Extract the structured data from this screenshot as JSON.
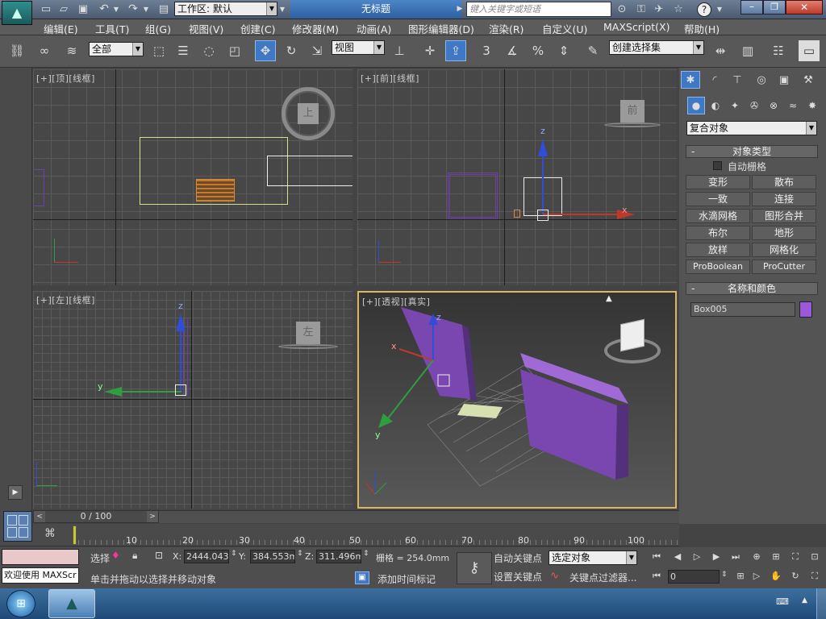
{
  "titlebar": {
    "workspace_label": "工作区: 默认",
    "doc_title": "无标题",
    "search_placeholder": "键入关键字或短语"
  },
  "menu": [
    "编辑(E)",
    "工具(T)",
    "组(G)",
    "视图(V)",
    "创建(C)",
    "修改器(M)",
    "动画(A)",
    "图形编辑器(D)",
    "渲染(R)",
    "自定义(U)",
    "MAXScript(X)",
    "帮助(H)"
  ],
  "toolbar": {
    "filter_value": "全部",
    "ref_coord_value": "视图",
    "snap_number": "3",
    "selection_set_value": "创建选择集"
  },
  "viewports": {
    "top": {
      "label": "[+][顶][线框]",
      "cube_label": "上"
    },
    "front": {
      "label": "[+][前][线框]",
      "cube_label": "前",
      "axis_x": "x",
      "axis_z": "z"
    },
    "left": {
      "label": "[+][左][线框]",
      "cube_label": "左",
      "axis_y": "y",
      "axis_z": "z"
    },
    "perspective": {
      "label": "[+][透视][真实]",
      "axis_x": "x",
      "axis_y": "y",
      "axis_z": "z"
    }
  },
  "command_panel": {
    "category_value": "复合对象",
    "object_type_header": "对象类型",
    "autogrid_label": "自动栅格",
    "buttons": [
      "变形",
      "散布",
      "一致",
      "连接",
      "水滴网格",
      "图形合并",
      "布尔",
      "地形",
      "放样",
      "网格化",
      "ProBoolean",
      "ProCutter"
    ],
    "name_color_header": "名称和颜色",
    "object_name": "Box005",
    "object_color": "#9b59d9"
  },
  "timeline": {
    "frame_display": "0 / 100",
    "ticks": [
      "10",
      "20",
      "30",
      "40",
      "50",
      "60",
      "70",
      "80",
      "90",
      "100"
    ]
  },
  "status": {
    "maxscript_label": "欢迎使用 MAXScr",
    "selection_label": "选择",
    "x_label": "X:",
    "x_value": "2444.043m",
    "y_label": "Y:",
    "y_value": "384.553mr",
    "z_label": "Z:",
    "z_value": "311.496mr",
    "grid_label": "栅格 = 254.0mm",
    "prompt": "单击并拖动以选择并移动对象",
    "add_time_tag": "添加时间标记",
    "auto_key": "自动关键点",
    "set_key": "设置关键点",
    "key_mode_value": "选定对象",
    "key_filters": "关键点过滤器...",
    "frame_field": "0"
  },
  "colors": {
    "accent": "#3f78c4",
    "object_purple": "#7a46b0",
    "wire_yellow": "#d6e08a"
  }
}
